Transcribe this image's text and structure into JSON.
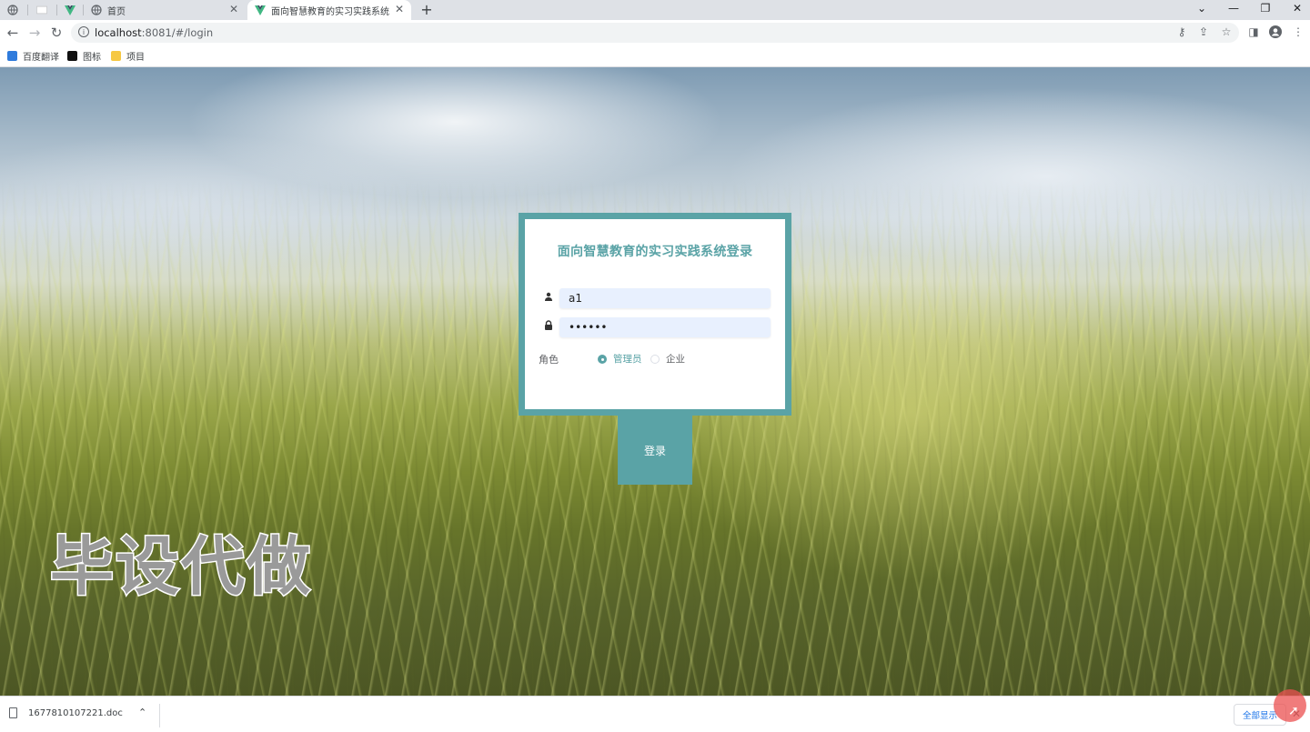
{
  "browser": {
    "tabs": [
      {
        "title": "",
        "icon": "globe-icon"
      },
      {
        "title": "",
        "icon": "blank-page-icon"
      },
      {
        "title": "",
        "icon": "vue-logo-icon"
      },
      {
        "title": "首页",
        "icon": "globe-icon",
        "close": "✕"
      },
      {
        "title": "面向智慧教育的实习实践系统",
        "icon": "vue-logo-icon",
        "close": "✕",
        "active": true
      }
    ],
    "new_tab": "+",
    "window_controls": {
      "dropdown": "⌄",
      "minimize": "—",
      "restore": "❐",
      "close": "✕"
    },
    "url_host": "localhost",
    "url_rest": ":8081/#/login",
    "bookmarks": [
      {
        "label": "百度翻译",
        "icon": "translate-icon",
        "color": "#2f7bdc"
      },
      {
        "label": "图标",
        "icon": "image-icon",
        "color": "#111111"
      },
      {
        "label": "项目",
        "icon": "folder-icon",
        "color": "#f6c843"
      }
    ]
  },
  "login": {
    "title": "面向智慧教育的实习实践系统登录",
    "username_value": "a1",
    "password_value": "••••••",
    "role_label": "角色",
    "roles": [
      {
        "label": "管理员",
        "checked": true
      },
      {
        "label": "企业",
        "checked": false
      }
    ],
    "submit_label": "登录"
  },
  "watermark": "毕设代做",
  "downloads": {
    "file_name": "1677810107221.doc",
    "show_all": "全部显示"
  },
  "colors": {
    "accent": "#5aa3a6",
    "field_bg": "#e8f0fe"
  }
}
